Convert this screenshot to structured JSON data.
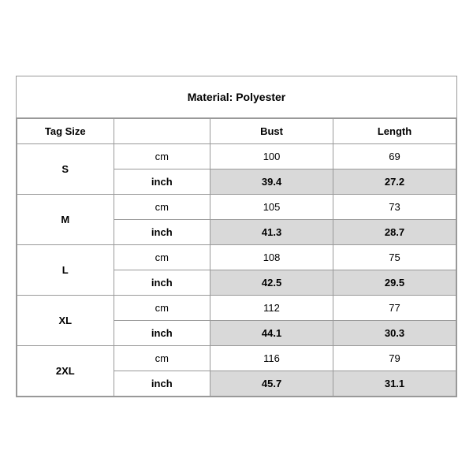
{
  "title": "Material: Polyester",
  "headers": {
    "tag_size": "Tag Size",
    "bust": "Bust",
    "length": "Length"
  },
  "sizes": [
    {
      "tag": "S",
      "cm": {
        "bust": "100",
        "length": "69"
      },
      "inch": {
        "bust": "39.4",
        "length": "27.2"
      }
    },
    {
      "tag": "M",
      "cm": {
        "bust": "105",
        "length": "73"
      },
      "inch": {
        "bust": "41.3",
        "length": "28.7"
      }
    },
    {
      "tag": "L",
      "cm": {
        "bust": "108",
        "length": "75"
      },
      "inch": {
        "bust": "42.5",
        "length": "29.5"
      }
    },
    {
      "tag": "XL",
      "cm": {
        "bust": "112",
        "length": "77"
      },
      "inch": {
        "bust": "44.1",
        "length": "30.3"
      }
    },
    {
      "tag": "2XL",
      "cm": {
        "bust": "116",
        "length": "79"
      },
      "inch": {
        "bust": "45.7",
        "length": "31.1"
      }
    }
  ],
  "unit_labels": {
    "cm": "cm",
    "inch": "inch"
  }
}
